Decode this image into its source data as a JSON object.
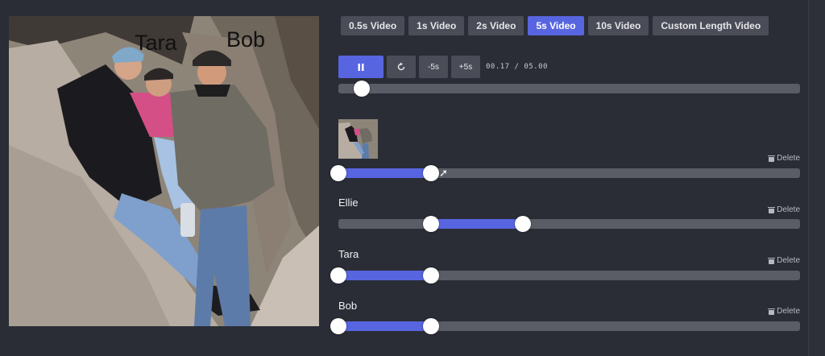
{
  "photo": {
    "labels": [
      "Tara",
      "Bob"
    ]
  },
  "tabs": [
    {
      "label": "0.5s Video",
      "active": false
    },
    {
      "label": "1s Video",
      "active": false
    },
    {
      "label": "2s Video",
      "active": false
    },
    {
      "label": "5s Video",
      "active": true
    },
    {
      "label": "10s Video",
      "active": false
    },
    {
      "label": "Custom Length Video",
      "active": false
    }
  ],
  "controls": {
    "play_icon": "pause-icon",
    "restart_icon": "restart-icon",
    "back_label": "-5s",
    "forward_label": "+5s",
    "timecode": "00.17 / 05.00"
  },
  "playback": {
    "progress_fraction": 0.034
  },
  "tracks": [
    {
      "name": "",
      "delete_label": "Delete",
      "has_thumbnail": true,
      "start_fraction": 0.0,
      "end_fraction": 0.2
    },
    {
      "name": "Ellie",
      "delete_label": "Delete",
      "has_thumbnail": false,
      "start_fraction": 0.2,
      "end_fraction": 0.4
    },
    {
      "name": "Tara",
      "delete_label": "Delete",
      "has_thumbnail": false,
      "start_fraction": 0.0,
      "end_fraction": 0.2
    },
    {
      "name": "Bob",
      "delete_label": "Delete",
      "has_thumbnail": false,
      "start_fraction": 0.0,
      "end_fraction": 0.2
    }
  ],
  "colors": {
    "accent": "#5865e0",
    "background": "#2a2d36",
    "track": "#5a5c66"
  }
}
